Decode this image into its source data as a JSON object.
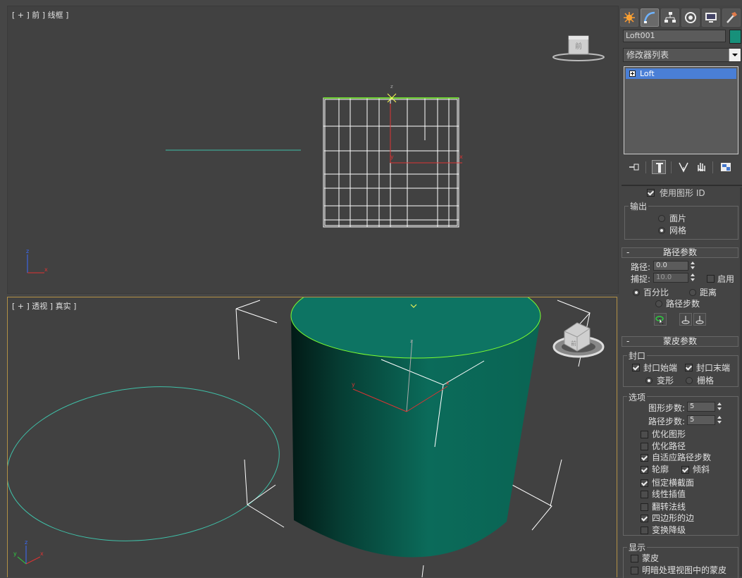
{
  "viewports": {
    "front": {
      "label": "[ + ] 前 ] 线框 ]"
    },
    "perspective": {
      "label": "[ + ] 透视 ] 真实 ]"
    }
  },
  "viewcube": {
    "front_face": "前"
  },
  "command_panel": {
    "tabs": [
      "create-icon",
      "modify-icon",
      "hierarchy-icon",
      "motion-icon",
      "display-icon",
      "utilities-icon"
    ],
    "object_name": "Loft001",
    "object_color": "#17907a",
    "modifier_list_label": "修改器列表",
    "stack_items": [
      "Loft"
    ]
  },
  "surface_params": {
    "use_shape_id_label": "使用图形 ID",
    "output_title": "输出",
    "output_patch_label": "面片",
    "output_mesh_label": "网格",
    "output_selected": "网格"
  },
  "path_params": {
    "title": "路径参数",
    "path_label": "路径:",
    "path_value": "0.0",
    "snap_label": "捕捉:",
    "snap_value": "10.0",
    "enable_label": "启用",
    "percent_label": "百分比",
    "distance_label": "距离",
    "path_steps_label": "路径步数",
    "selected_mode": "百分比"
  },
  "skin_params": {
    "title": "蒙皮参数",
    "capping_title": "封口",
    "cap_start_label": "封口始端",
    "cap_end_label": "封口末端",
    "morph_label": "变形",
    "grid_label": "栅格",
    "options_title": "选项",
    "shape_steps_label": "图形步数:",
    "shape_steps_value": "5",
    "path_steps_label": "路径步数:",
    "path_steps_value": "5",
    "optimize_shapes_label": "优化图形",
    "optimize_path_label": "优化路径",
    "adaptive_path_steps_label": "自适应路径步数",
    "contour_label": "轮廓",
    "banking_label": "倾斜",
    "constant_cross_section_label": "恒定横截面",
    "linear_interpolation_label": "线性插值",
    "flip_normals_label": "翻转法线",
    "quad_sides_label": "四边形的边",
    "transform_degrade_label": "变换降级",
    "display_title": "显示",
    "skin_label": "蒙皮",
    "skin_in_shaded_label": "明暗处理视图中的蒙皮"
  },
  "colors": {
    "viewport_bg": "#414141",
    "active_border": "#b29046",
    "object_teal": "#0b6e5c",
    "selection_green": "#7dff2f"
  }
}
